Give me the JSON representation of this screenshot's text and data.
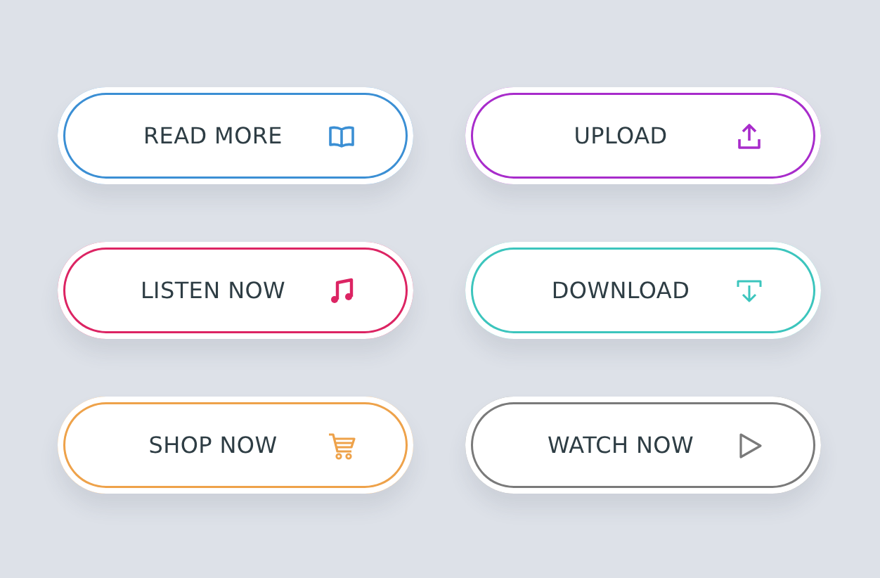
{
  "buttons": [
    {
      "label": "READ MORE",
      "color": "#3b8fd4"
    },
    {
      "label": "UPLOAD",
      "color": "#a82ccb"
    },
    {
      "label": "LISTEN NOW",
      "color": "#dc2463"
    },
    {
      "label": "DOWNLOAD",
      "color": "#3cc5bd"
    },
    {
      "label": "SHOP NOW",
      "color": "#eea24a"
    },
    {
      "label": "WATCH NOW",
      "color": "#7a7a7a"
    }
  ]
}
